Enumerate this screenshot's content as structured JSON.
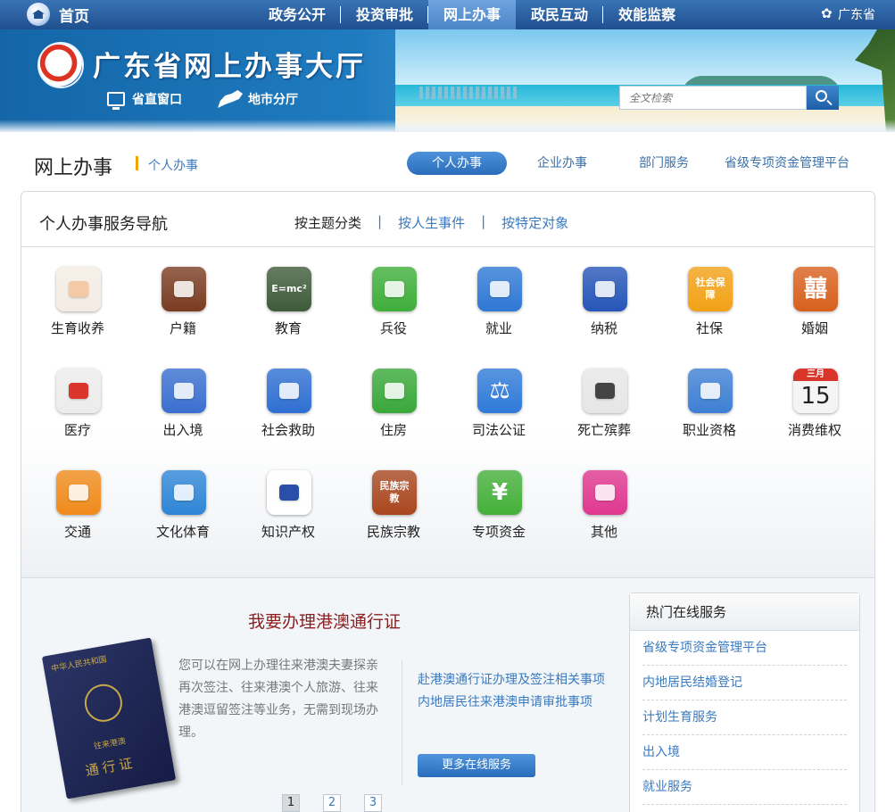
{
  "topnav": {
    "home_label": "首页",
    "items": [
      "政务公开",
      "投资审批",
      "网上办事",
      "政民互动",
      "效能监察"
    ],
    "active_index": 2,
    "region_label": "广东省"
  },
  "banner": {
    "site_title": "广东省网上办事大厅",
    "links": [
      "省直窗口",
      "地市分厅"
    ],
    "search_placeholder": "全文检索"
  },
  "section": {
    "title": "网上办事",
    "subtitle": "个人办事",
    "tabs": [
      "个人办事",
      "企业办事",
      "部门服务",
      "省级专项资金管理平台"
    ],
    "active_tab": 0
  },
  "panel": {
    "title": "个人办事服务导航",
    "category_tabs": [
      "按主题分类",
      "按人生事件",
      "按特定对象"
    ],
    "separator": "|",
    "services": [
      {
        "label": "生育收养",
        "icon": "baby-icon",
        "glyph": "",
        "color": "#f4ece4"
      },
      {
        "label": "户籍",
        "icon": "household-book-icon",
        "glyph": "",
        "color": "#7a3c22"
      },
      {
        "label": "教育",
        "icon": "chalkboard-icon",
        "glyph": "E=mc²",
        "color": "#3f5b3a"
      },
      {
        "label": "兵役",
        "icon": "military-cap-icon",
        "glyph": "",
        "color": "#3fae3a"
      },
      {
        "label": "就业",
        "icon": "briefcase-icon",
        "glyph": "",
        "color": "#2f78d4"
      },
      {
        "label": "纳税",
        "icon": "tax-emblem-icon",
        "glyph": "",
        "color": "#2656b8"
      },
      {
        "label": "社保",
        "icon": "social-security-icon",
        "glyph": "社会保障",
        "color": "#f2a116"
      },
      {
        "label": "婚姻",
        "icon": "double-happiness-icon",
        "glyph": "囍",
        "color": "#d8601d"
      },
      {
        "label": "医疗",
        "icon": "medical-kit-icon",
        "glyph": "",
        "color": "#ececec"
      },
      {
        "label": "出入境",
        "icon": "globe-network-icon",
        "glyph": "",
        "color": "#3a6fd0"
      },
      {
        "label": "社会救助",
        "icon": "assistance-icon",
        "glyph": "",
        "color": "#2f6fd2"
      },
      {
        "label": "住房",
        "icon": "house-icon",
        "glyph": "",
        "color": "#3aa83a"
      },
      {
        "label": "司法公证",
        "icon": "scales-icon",
        "glyph": "⚖",
        "color": "#2f7ad8"
      },
      {
        "label": "死亡殡葬",
        "icon": "people-silhouette-icon",
        "glyph": "",
        "color": "#e6e6e6"
      },
      {
        "label": "职业资格",
        "icon": "certificate-icon",
        "glyph": "",
        "color": "#3e7fd4"
      },
      {
        "label": "消费维权",
        "icon": "calendar-icon",
        "glyph": "15",
        "color": "#f4f4f4"
      },
      {
        "label": "交通",
        "icon": "car-icon",
        "glyph": "",
        "color": "#f08b1c"
      },
      {
        "label": "文化体育",
        "icon": "sports-icon",
        "glyph": "",
        "color": "#2f86d6"
      },
      {
        "label": "知识产权",
        "icon": "ip-logo-icon",
        "glyph": "",
        "color": "#ffffff"
      },
      {
        "label": "民族宗教",
        "icon": "ethnic-religion-icon",
        "glyph": "民族宗教",
        "color": "#a9471f"
      },
      {
        "label": "专项资金",
        "icon": "yuan-icon",
        "glyph": "¥",
        "color": "#45b03a"
      },
      {
        "label": "其他",
        "icon": "monitor-icon",
        "glyph": "",
        "color": "#e0388f"
      }
    ],
    "calendar_month": "三月"
  },
  "promo": {
    "title": "我要办理港澳通行证",
    "passport_lines": [
      "中华人民共和国",
      "往来港澳",
      "通行证"
    ],
    "description": "您可以在网上办理往来港澳夫妻探亲再次签注、往来港澳个人旅游、往来港澳逗留签注等业务，无需到现场办理。",
    "links": [
      "赴港澳通行证办理及签注相关事项",
      "内地居民往来港澳申请审批事项"
    ],
    "more_button": "更多在线服务",
    "pages": [
      "1",
      "2",
      "3"
    ],
    "active_page": 0
  },
  "hot_services": {
    "title": "热门在线服务",
    "items": [
      "省级专项资金管理平台",
      "内地居民结婚登记",
      "计划生育服务",
      "出入境",
      "就业服务"
    ]
  }
}
